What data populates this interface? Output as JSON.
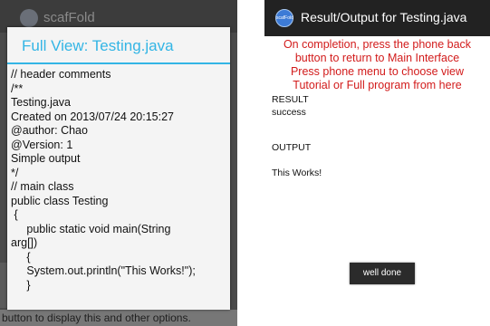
{
  "left_phone": {
    "background_app_title": "scafFold",
    "background_hint": "button to display this and other options.",
    "dialog": {
      "title": "Full View: Testing.java",
      "code_lines": [
        "// header comments",
        "/**",
        "Testing.java",
        "Created on 2013/07/24 20:15:27",
        "@author: Chao",
        "@Version: 1",
        "Simple output",
        "",
        "*/",
        "// main class",
        "public class Testing",
        " {",
        "     public static void main(String",
        "arg[])",
        "     {",
        "     System.out.println(\"This Works!\");",
        "     }"
      ]
    }
  },
  "right_phone": {
    "title": "Result/Output for Testing.java",
    "logo_text": "scafFold",
    "instructions": [
      "On completion, press the phone back",
      "button to return to Main Interface",
      "Press phone menu to choose view",
      "Tutorial or Full program from here"
    ],
    "result_label": "RESULT",
    "result_value": "success",
    "output_label": "OUTPUT",
    "output_value": "This Works!",
    "toast": "well done"
  },
  "colors": {
    "accent_blue": "#33b5e5",
    "instruction_red": "#d21b1b",
    "action_bar": "#222222",
    "toast_bg": "#2b2b2b"
  }
}
